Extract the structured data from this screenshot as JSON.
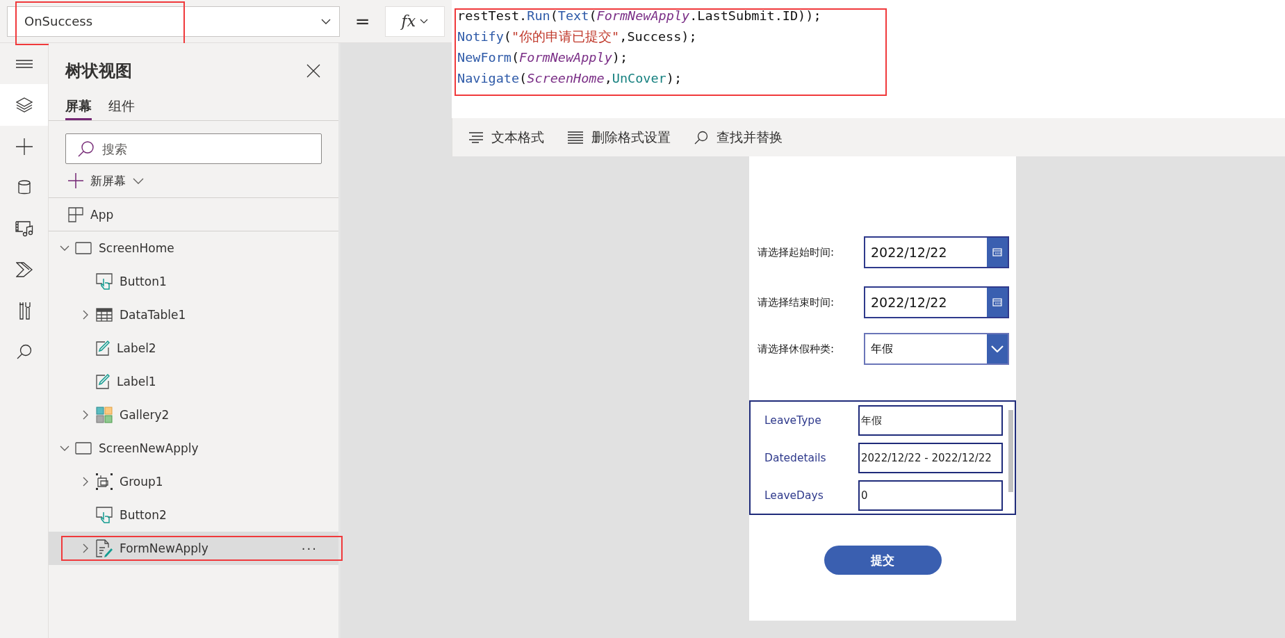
{
  "property_bar": {
    "property": "OnSuccess",
    "highlighted": true,
    "equals": "=",
    "fx": "fx"
  },
  "formula": {
    "highlighted": true,
    "lines": [
      {
        "tokens": [
          {
            "text": "restTest.",
            "kind": "plain"
          },
          {
            "text": "Run",
            "kind": "func"
          },
          {
            "text": "(",
            "kind": "plain"
          },
          {
            "text": "Text",
            "kind": "func"
          },
          {
            "text": "(",
            "kind": "plain"
          },
          {
            "text": "FormNewApply",
            "kind": "ident"
          },
          {
            "text": ".LastSubmit.ID));",
            "kind": "plain"
          }
        ]
      },
      {
        "tokens": [
          {
            "text": "Notify",
            "kind": "func"
          },
          {
            "text": "(",
            "kind": "plain"
          },
          {
            "text": "\"你的申请已提交\"",
            "kind": "string"
          },
          {
            "text": ",Success);",
            "kind": "plain"
          }
        ]
      },
      {
        "tokens": [
          {
            "text": "NewForm",
            "kind": "func"
          },
          {
            "text": "(",
            "kind": "plain"
          },
          {
            "text": "FormNewApply",
            "kind": "ident"
          },
          {
            "text": ");",
            "kind": "plain"
          }
        ]
      },
      {
        "tokens": [
          {
            "text": "Navigate",
            "kind": "func"
          },
          {
            "text": "(",
            "kind": "plain"
          },
          {
            "text": "ScreenHome",
            "kind": "ident"
          },
          {
            "text": ",",
            "kind": "plain"
          },
          {
            "text": "UnCover",
            "kind": "enum"
          },
          {
            "text": ");",
            "kind": "plain"
          }
        ]
      }
    ]
  },
  "format_toolbar": [
    {
      "label": "文本格式",
      "kind": "format"
    },
    {
      "label": "删除格式设置",
      "kind": "clear"
    },
    {
      "label": "查找并替换",
      "kind": "find"
    }
  ],
  "rail": [
    {
      "kind": "menu",
      "selected": false
    },
    {
      "kind": "layers",
      "selected": true
    },
    {
      "kind": "plus",
      "selected": false
    },
    {
      "kind": "database",
      "selected": false
    },
    {
      "kind": "media",
      "selected": false
    },
    {
      "kind": "flow",
      "selected": false
    },
    {
      "kind": "tools",
      "selected": false
    },
    {
      "kind": "search",
      "selected": false
    }
  ],
  "tree_view": {
    "title": "树状视图",
    "tabs": [
      {
        "label": "屏幕",
        "selected": true
      },
      {
        "label": "组件",
        "selected": false
      }
    ],
    "search": {
      "placeholder": "搜索"
    },
    "new_screen": "新屏幕",
    "app": {
      "label": "App"
    },
    "items": [
      {
        "label": "ScreenHome",
        "kind": "screen",
        "expanded": true,
        "selected": false,
        "children": [
          {
            "label": "Button1",
            "kind": "button",
            "selected": false
          },
          {
            "label": "DataTable1",
            "kind": "table",
            "expanded": false,
            "selected": false
          },
          {
            "label": "Label2",
            "kind": "label",
            "selected": false
          },
          {
            "label": "Label1",
            "kind": "label",
            "selected": false
          },
          {
            "label": "Gallery2",
            "kind": "gallery",
            "expanded": false,
            "selected": false
          }
        ]
      },
      {
        "label": "ScreenNewApply",
        "kind": "screen",
        "expanded": true,
        "selected": false,
        "children": [
          {
            "label": "Group1",
            "kind": "group",
            "expanded": false,
            "selected": false
          },
          {
            "label": "Button2",
            "kind": "button",
            "selected": false
          },
          {
            "label": "FormNewApply",
            "kind": "form",
            "expanded": false,
            "selected": true,
            "highlighted": true,
            "more": "···"
          }
        ]
      }
    ]
  },
  "app_screen": {
    "inputs": [
      {
        "label": "请选择起始时间:",
        "value": "2022/12/22",
        "kind": "date"
      },
      {
        "label": "请选择结束时间:",
        "value": "2022/12/22",
        "kind": "date"
      },
      {
        "label": "请选择休假种类:",
        "value": "年假",
        "kind": "dropdown"
      }
    ],
    "form_fields": [
      {
        "label": "LeaveType",
        "value": "年假"
      },
      {
        "label": "Datedetails",
        "value": "2022/12/22 - 2022/12/22"
      },
      {
        "label": "LeaveDays",
        "value": "0"
      }
    ],
    "submit": "提交"
  }
}
